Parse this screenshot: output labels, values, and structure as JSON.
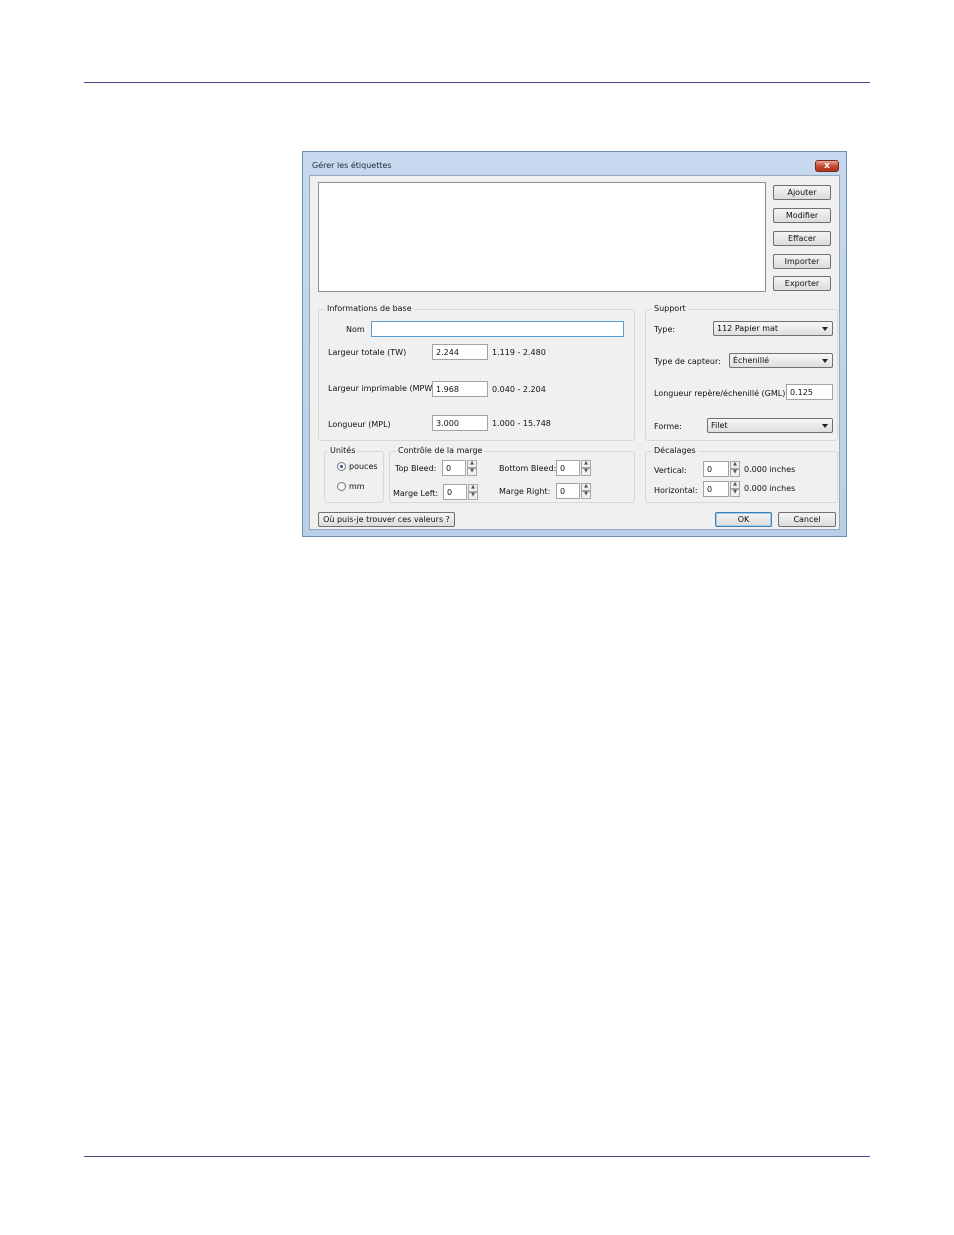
{
  "dialog": {
    "title": "Gérer les étiquettes",
    "close_glyph": "x",
    "actions": {
      "add": "Ajouter",
      "modify": "Modifier",
      "delete": "Effacer",
      "import": "Importer",
      "export": "Exporter"
    },
    "basic_info": {
      "legend": "Informations de base",
      "name_label": "Nom",
      "name_value": "",
      "total_width_label": "Largeur totale (TW)",
      "total_width_value": "2.244",
      "total_width_range": "1.119 - 2.480",
      "printable_width_label": "Largeur imprimable (MPW)",
      "printable_width_value": "1.968",
      "printable_width_range": "0.040 - 2.204",
      "length_label": "Longueur (MPL)",
      "length_value": "3.000",
      "length_range": "1.000 - 15.748"
    },
    "support": {
      "legend": "Support",
      "type_label": "Type:",
      "type_value": "112 Papier mat",
      "sensor_label": "Type de capteur:",
      "sensor_value": "Échenillé",
      "gml_label": "Longueur repère/échenillé (GML):",
      "gml_value": "0.125",
      "shape_label": "Forme:",
      "shape_value": "Filet"
    },
    "units": {
      "legend": "Unités",
      "inches_label": "pouces",
      "mm_label": "mm",
      "selected": "pouces"
    },
    "margin": {
      "legend": "Contrôle de la marge",
      "top_bleed_label": "Top Bleed:",
      "top_bleed_value": "0",
      "bottom_bleed_label": "Bottom Bleed:",
      "bottom_bleed_value": "0",
      "left_label": "Marge Left:",
      "left_value": "0",
      "right_label": "Marge Right:",
      "right_value": "0"
    },
    "offsets": {
      "legend": "Décalages",
      "vertical_label": "Vertical:",
      "vertical_value": "0",
      "vertical_readout": "0.000 inches",
      "horizontal_label": "Horizontal:",
      "horizontal_value": "0",
      "horizontal_readout": "0.000 inches"
    },
    "help_button": "Où puis-je trouver ces valeurs ?",
    "ok_button": "OK",
    "cancel_button": "Cancel",
    "spin_up": "▲",
    "spin_down": "▼"
  }
}
